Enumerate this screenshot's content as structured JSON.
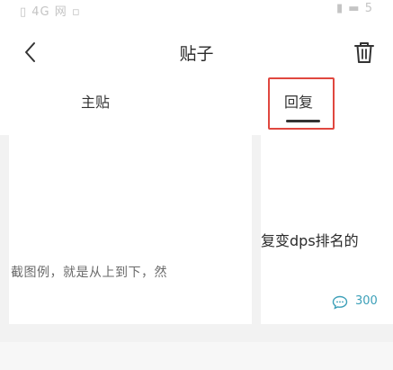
{
  "status_bar": {
    "left_text": "▯ 4G 网 ▫",
    "right_text": "▮ ▬ 5"
  },
  "header": {
    "title": "贴子"
  },
  "tabs": [
    {
      "label": "主贴"
    },
    {
      "label": "回复"
    }
  ],
  "content": {
    "left_snippet": "截图例，就是从上到下，然",
    "right_snippet": "复变dps排名的",
    "comment_count": "300"
  },
  "colors": {
    "highlight": "#e0473f",
    "comment": "#3b9fb8"
  }
}
